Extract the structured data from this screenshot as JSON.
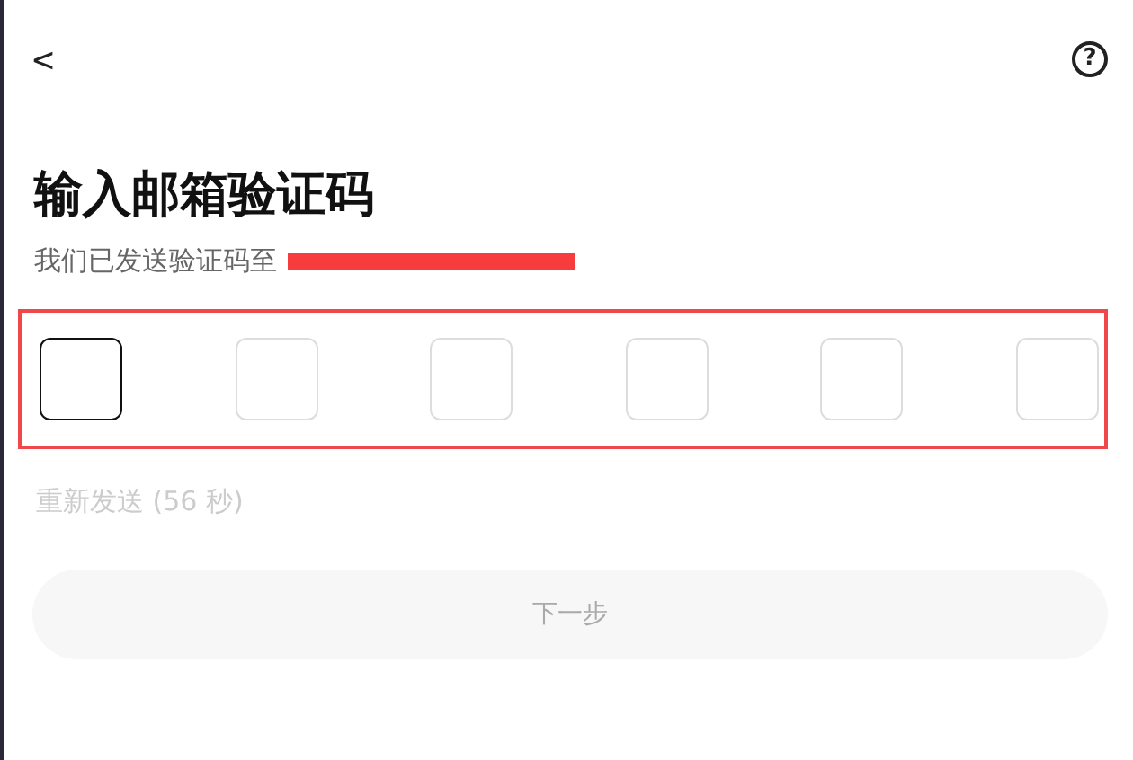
{
  "header": {
    "back": "<",
    "help": "?"
  },
  "title": "输入邮箱验证码",
  "subtitle": "我们已发送验证码至",
  "email_redacted": true,
  "code_boxes": [
    {
      "focused": true
    },
    {
      "focused": false
    },
    {
      "focused": false
    },
    {
      "focused": false
    },
    {
      "focused": false
    },
    {
      "focused": false
    }
  ],
  "highlight": true,
  "resend": {
    "label": "重新发送 (56 秒)",
    "disabled": true
  },
  "next_button": {
    "label": "下一步",
    "disabled": true
  }
}
